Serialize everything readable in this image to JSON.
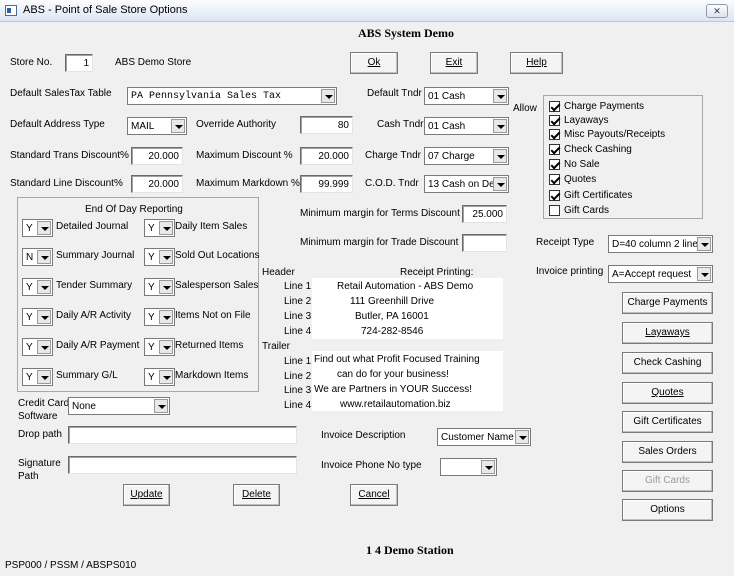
{
  "window": {
    "title": "ABS - Point of Sale Store Options",
    "close_glyph": "✕",
    "icon": "app-icon"
  },
  "header": {
    "system_name": "ABS System Demo",
    "footer_station": "1  4 Demo Station",
    "footer_code": "PSP000 / PSSM / ABSPS010"
  },
  "store": {
    "label": "Store No.",
    "number": "1",
    "name": "ABS Demo Store"
  },
  "top_buttons": {
    "ok": "Ok",
    "exit": "Exit",
    "help": "Help"
  },
  "tax": {
    "label": "Default SalesTax Table",
    "value": "PA  Pennsylvania Sales Tax"
  },
  "address": {
    "label": "Default Address Type",
    "value": "MAIL"
  },
  "override": {
    "label": "Override Authority",
    "value": "80"
  },
  "std_trans": {
    "label": "Standard Trans Discount%",
    "value": "20.000"
  },
  "max_disc": {
    "label": "Maximum Discount %",
    "value": "20.000"
  },
  "std_line": {
    "label": "Standard Line Discount%",
    "value": "20.000"
  },
  "max_markdown": {
    "label": "Maximum Markdown %",
    "value": "99.999"
  },
  "tenders": {
    "default": {
      "label": "Default Tndr",
      "value": "01 Cash"
    },
    "cash": {
      "label": "Cash Tndr",
      "value": "01 Cash"
    },
    "charge": {
      "label": "Charge Tndr",
      "value": "07 Charge"
    },
    "cod": {
      "label": "C.O.D. Tndr",
      "value": "13 Cash on De"
    }
  },
  "allow": {
    "label": "Allow",
    "items": [
      {
        "label": "Charge Payments",
        "checked": true
      },
      {
        "label": "Layaways",
        "checked": true
      },
      {
        "label": "Misc Payouts/Receipts",
        "checked": true
      },
      {
        "label": "Check Cashing",
        "checked": true
      },
      {
        "label": "No Sale",
        "checked": true
      },
      {
        "label": "Quotes",
        "checked": true
      },
      {
        "label": "Gift Certificates",
        "checked": true
      },
      {
        "label": "Gift Cards",
        "checked": false
      }
    ]
  },
  "eod": {
    "title": "End Of Day Reporting",
    "left": [
      {
        "value": "Y",
        "label": "Detailed Journal"
      },
      {
        "value": "N",
        "label": "Summary Journal"
      },
      {
        "value": "Y",
        "label": "Tender Summary"
      },
      {
        "value": "Y",
        "label": "Daily A/R Activity"
      },
      {
        "value": "Y",
        "label": "Daily A/R Payment"
      },
      {
        "value": "Y",
        "label": "Summary G/L"
      }
    ],
    "right": [
      {
        "value": "Y",
        "label": "Daily Item Sales"
      },
      {
        "value": "Y",
        "label": "Sold Out Locations"
      },
      {
        "value": "Y",
        "label": "Salesperson Sales"
      },
      {
        "value": "Y",
        "label": "Items Not on File"
      },
      {
        "value": "Y",
        "label": "Returned Items"
      },
      {
        "value": "Y",
        "label": "Markdown Items"
      }
    ]
  },
  "margins": {
    "terms_label": "Minimum margin for Terms Discount",
    "terms_value": "25.000",
    "trade_label": "Minimum margin for Trade Discount",
    "trade_value": ""
  },
  "receipt_type": {
    "label": "Receipt Type",
    "value": "D=40 column 2 line"
  },
  "invoicing": {
    "label": "Invoice printing",
    "value": "A=Accept request"
  },
  "receipt": {
    "title": "Receipt Printing:",
    "header_label": "Header",
    "trailer_label": "Trailer",
    "line_labels": [
      "Line 1",
      "Line 2",
      "Line 3",
      "Line 4"
    ],
    "header_lines": [
      "Retail Automation - ABS Demo",
      "111 Greenhill Drive",
      "Butler, PA 16001",
      "724-282-8546"
    ],
    "trailer_lines": [
      "Find out what Profit Focused Training",
      "can do for your business!",
      "We are Partners in YOUR Success!",
      "www.retailautomation.biz"
    ]
  },
  "side_buttons": {
    "charge_payments": "Charge Payments",
    "layaways": "Layaways",
    "check_cashing": "Check Cashing",
    "quotes": "Quotes",
    "gift_certificates": "Gift Certificates",
    "sales_orders": "Sales Orders",
    "gift_cards": "Gift Cards",
    "options": "Options"
  },
  "credit": {
    "label": "Credit Card\nSoftware",
    "value": "None"
  },
  "drop_path": {
    "label": "Drop path",
    "value": ""
  },
  "signature": {
    "label": "Signature\nPath",
    "value": ""
  },
  "invoice_desc": {
    "label": "Invoice Description",
    "value": "Customer Name"
  },
  "invoice_phone": {
    "label": "Invoice Phone No type",
    "value": ""
  },
  "bottom_buttons": {
    "update": "Update",
    "delete": "Delete",
    "cancel": "Cancel"
  }
}
